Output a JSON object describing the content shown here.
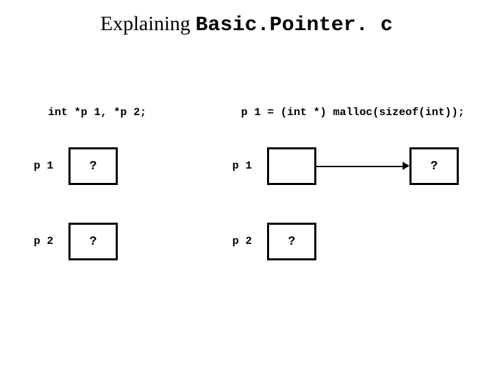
{
  "title": {
    "prefix": "Explaining ",
    "mono": "Basic.Pointer. c"
  },
  "left": {
    "code": "int *p 1, *p 2;",
    "p1": {
      "label": "p 1",
      "value": "?"
    },
    "p2": {
      "label": "p 2",
      "value": "?"
    }
  },
  "right": {
    "code": "p 1 = (int *) malloc(sizeof(int));",
    "p1": {
      "label": "p 1",
      "box": "",
      "heap": "?"
    },
    "p2": {
      "label": "p 2",
      "value": "?"
    }
  }
}
